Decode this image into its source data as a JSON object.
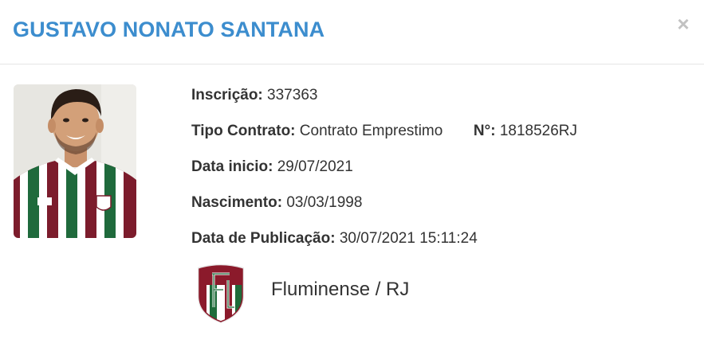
{
  "header": {
    "title": "GUSTAVO NONATO SANTANA",
    "close_label": "×"
  },
  "details": {
    "inscricao": {
      "label": "Inscrição:",
      "value": "337363"
    },
    "tipo_contrato": {
      "label": "Tipo Contrato:",
      "value": "Contrato Emprestimo"
    },
    "numero": {
      "label": "N°:",
      "value": "1818526RJ"
    },
    "data_inicio": {
      "label": "Data inicio:",
      "value": "29/07/2021"
    },
    "nascimento": {
      "label": "Nascimento:",
      "value": "03/03/1998"
    },
    "data_publicacao": {
      "label": "Data de Publicação:",
      "value": "30/07/2021 15:11:24"
    }
  },
  "club": {
    "name": "Fluminense / RJ",
    "crest_icon": "fluminense-crest-icon",
    "colors": {
      "grena": "#8b1a2b",
      "green": "#1e6b3a",
      "white": "#ffffff"
    }
  },
  "colors": {
    "title": "#3c8dce",
    "text": "#333333",
    "divider": "#e5e5e5",
    "close": "#c2c2c2"
  }
}
